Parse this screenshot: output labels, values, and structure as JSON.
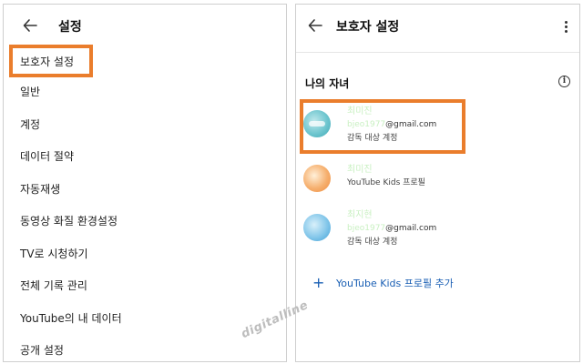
{
  "left_panel": {
    "title": "설정",
    "items": [
      {
        "label": "보호자 설정"
      },
      {
        "label": "일반"
      },
      {
        "label": "계정"
      },
      {
        "label": "데이터 절약"
      },
      {
        "label": "자동재생"
      },
      {
        "label": "동영상 화질 환경설정"
      },
      {
        "label": "TV로 시청하기"
      },
      {
        "label": "전체 기록 관리"
      },
      {
        "label": "YouTube의 내 데이터"
      },
      {
        "label": "공개 설정"
      }
    ]
  },
  "right_panel": {
    "title": "보호자 설정",
    "section_title": "나의 자녀",
    "children": [
      {
        "name": "최미진",
        "email_blur": "bjeo1977",
        "email_domain": "@gmail.com",
        "subtitle": "감독 대상 계정"
      },
      {
        "name": "최미진",
        "subtitle": "YouTube Kids 프로필"
      },
      {
        "name": "최지현",
        "email_blur": "bjeo1977",
        "email_domain": "@gmail.com",
        "subtitle": "감독 대상 계정"
      }
    ],
    "add_label": "YouTube Kids 프로필 추가"
  },
  "watermark": "digitalline",
  "colors": {
    "highlight": "#ea7d2c",
    "link": "#1a5fb4"
  }
}
